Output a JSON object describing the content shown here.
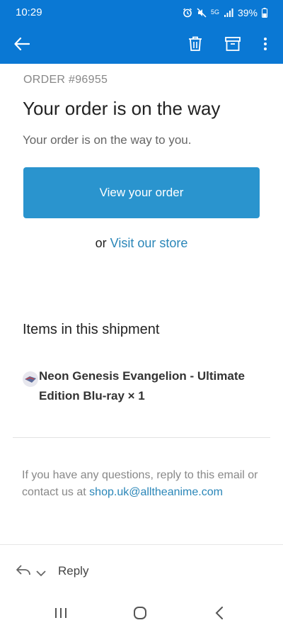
{
  "status_bar": {
    "time": "10:29",
    "network": "5G",
    "battery_percent": "39%",
    "icons": [
      "alarm-icon",
      "mute-icon",
      "signal-icon",
      "battery-icon"
    ]
  },
  "app_bar": {
    "icons": [
      "back-arrow-icon",
      "delete-icon",
      "archive-icon",
      "more-vert-icon"
    ],
    "color": "#0a78d4"
  },
  "email": {
    "order_number": "ORDER #96955",
    "headline": "Your order is on the way",
    "subtext": "Your order is on the way to you.",
    "view_order_label": "View your order",
    "store_prefix": "or",
    "store_link": "Visit our store",
    "items_heading": "Items in this shipment",
    "items": [
      {
        "title": "Neon Genesis Evangelion - Ultimate Edition Blu-ray × 1"
      }
    ],
    "footer_text": "If you have any questions, reply to this email or contact us at",
    "footer_email": "shop.uk@alltheanime.com",
    "button_color": "#2a94ce",
    "link_color": "#2a86b8"
  },
  "reply_bar": {
    "label": "Reply"
  },
  "nav_bar": {
    "icons": [
      "recents-icon",
      "home-icon",
      "back-icon"
    ]
  }
}
